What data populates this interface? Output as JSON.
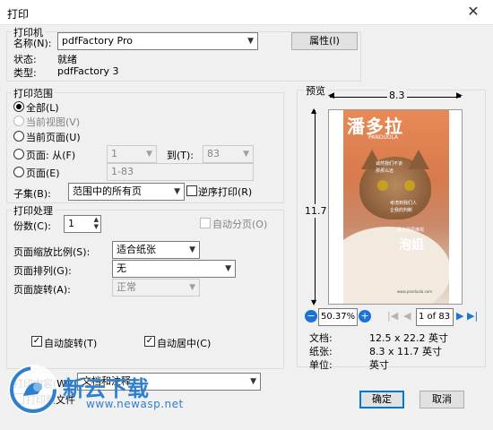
{
  "window": {
    "title": "打印",
    "close": "✕"
  },
  "printer": {
    "legend": "打印机",
    "name_label": "名称(N):",
    "name_value": "pdfFactory Pro",
    "properties_button": "属性(I)",
    "status_label": "状态:",
    "status_value": "就绪",
    "type_label": "类型:",
    "type_value": "pdfFactory 3"
  },
  "range": {
    "legend": "打印范围",
    "all": "全部(L)",
    "current_view": "当前视图(V)",
    "current_page": "当前页面(U)",
    "pages_from": "页面: 从(F)",
    "from_value": "1",
    "to_label": "到(T):",
    "to_value": "83",
    "pages": "页面(E)",
    "pages_value": "1-83",
    "subset_label": "子集(B):",
    "subset_value": "范围中的所有页",
    "reverse": "逆序打印(R)"
  },
  "handling": {
    "legend": "打印处理",
    "copies_label": "份数(C):",
    "copies_value": "1",
    "collate": "自动分页(O)",
    "scaling_label": "页面缩放比例(S):",
    "scaling_value": "适合纸张",
    "arrangement_label": "页面排列(G):",
    "arrangement_value": "无",
    "rotation_label": "页面旋转(A):",
    "rotation_value": "正常",
    "auto_rotate": "自动旋转(T)",
    "auto_center": "自动居中(C)"
  },
  "print_what": {
    "label": "打印内容(W):",
    "value": "文档和注释",
    "print_to_file": "打印到文件"
  },
  "preview": {
    "legend": "预览",
    "width_label": "8.3",
    "height_label": "11.7",
    "zoom": "50.37%",
    "page_field": "1 of 83",
    "doc_label": "文档:",
    "doc_value": "12.5 x 22.2 英寸",
    "paper_label": "纸张:",
    "paper_value": "8.3 x 11.7 英寸",
    "unit_label": "单位:",
    "unit_value": "英寸",
    "magazine": {
      "title": "潘多拉",
      "subtitle": "PANDUOLA",
      "line1": "诚然我们不该",
      "line2": "那那么远",
      "line3": "考虑到我们人",
      "line4": "企我的判断",
      "line5": "那样我思维观",
      "big": "泡姐",
      "footer": "www.panduola.com"
    }
  },
  "buttons": {
    "ok": "确定",
    "cancel": "取消"
  },
  "watermark": {
    "name": "新云下载",
    "url": "www.newasp.net"
  },
  "colors": {
    "accent": "#0078d7",
    "group_border": "#d5dfe5",
    "magazine_bg": "#d77a4d"
  }
}
